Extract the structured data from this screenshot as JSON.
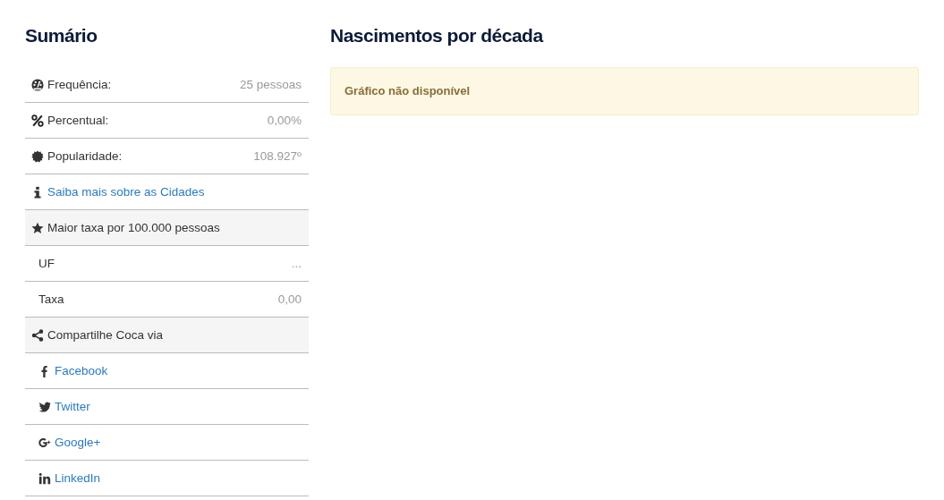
{
  "summary": {
    "title": "Sumário",
    "rows": [
      {
        "kind": "stat",
        "label": "Frequência:",
        "value": "25 pessoas"
      },
      {
        "kind": "stat",
        "label": "Percentual:",
        "value": "0,00%"
      },
      {
        "kind": "stat",
        "label": "Popularidade:",
        "value": "108.927º"
      },
      {
        "kind": "link",
        "label": "Saiba mais sobre as Cidades"
      },
      {
        "kind": "header",
        "label": "Maior taxa por 100.000 pessoas"
      },
      {
        "kind": "detail",
        "label": "UF",
        "value": "..."
      },
      {
        "kind": "detail",
        "label": "Taxa",
        "value": "0,00"
      },
      {
        "kind": "header",
        "label": "Compartilhe Coca via"
      },
      {
        "kind": "share",
        "label": "Facebook"
      },
      {
        "kind": "share",
        "label": "Twitter"
      },
      {
        "kind": "share",
        "label": "Google+"
      },
      {
        "kind": "share",
        "label": "LinkedIn"
      }
    ]
  },
  "births": {
    "title": "Nascimentos por década",
    "alert": "Gráfico não disponível"
  }
}
